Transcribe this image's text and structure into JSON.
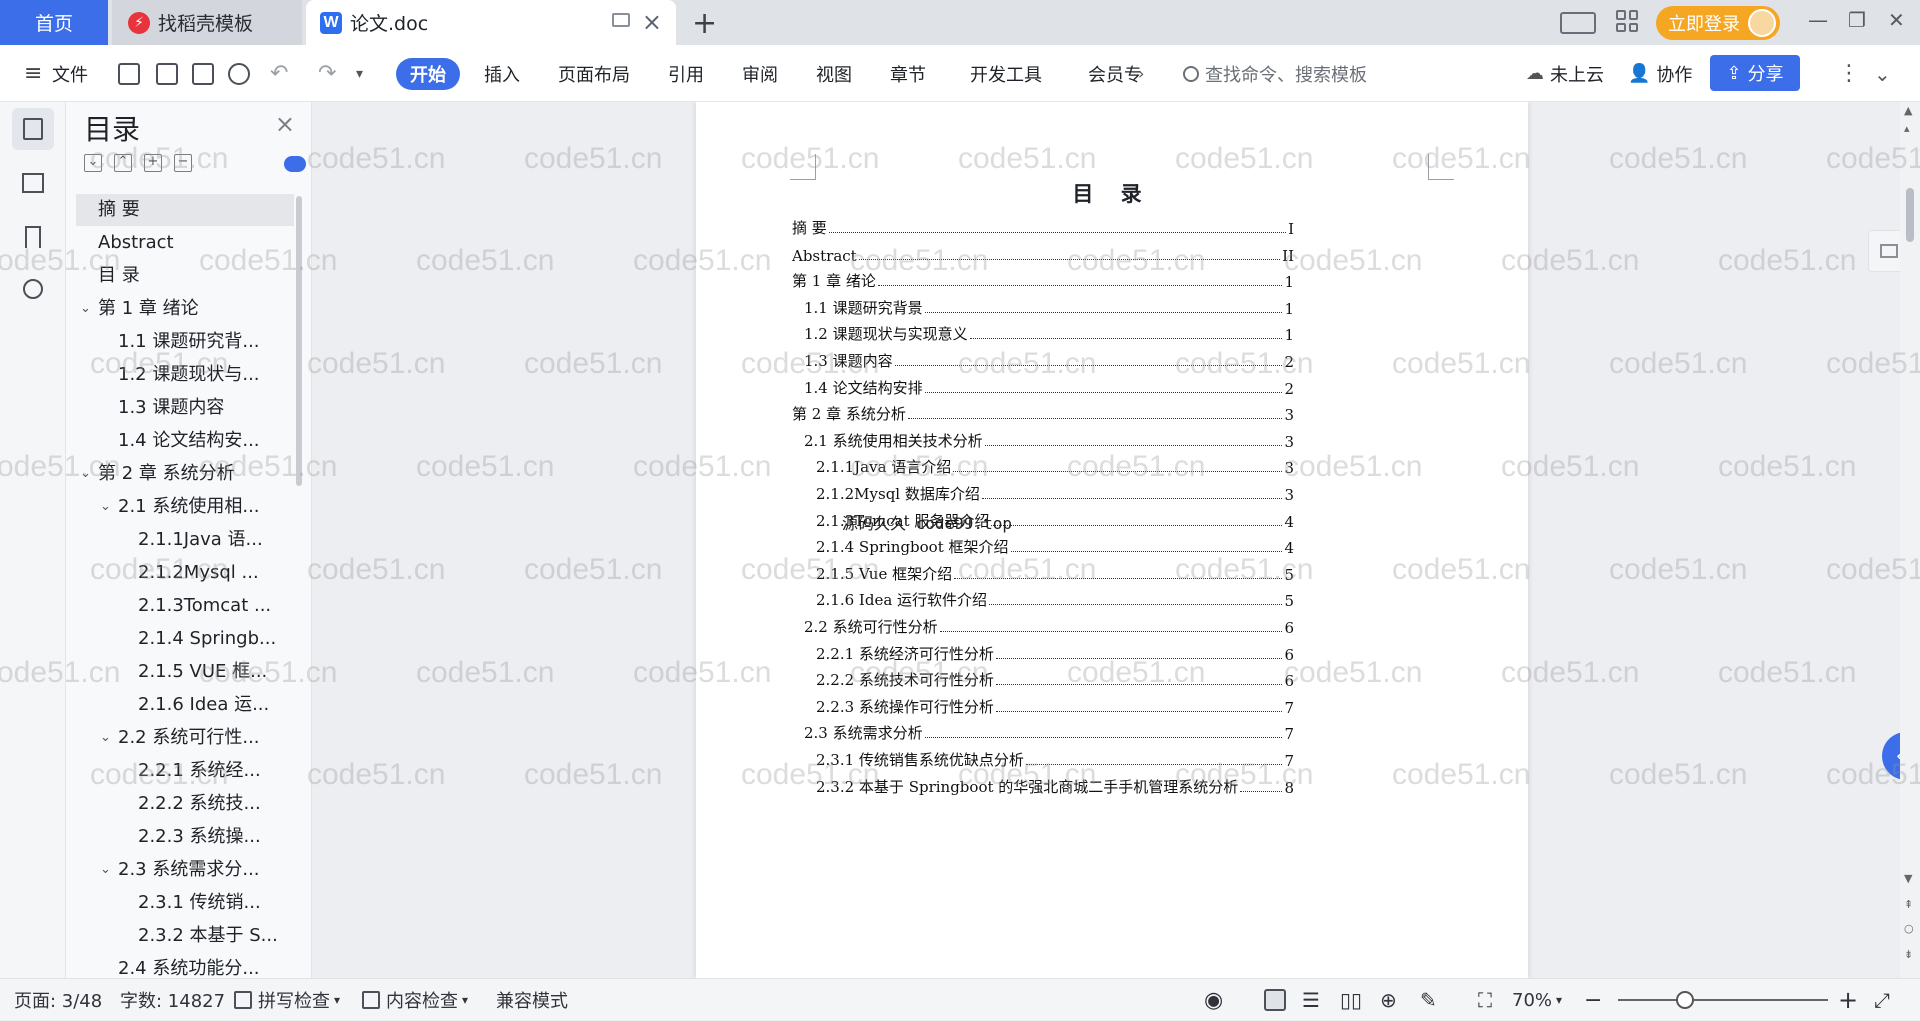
{
  "tabs": {
    "home": "首页",
    "template": "找稻壳模板",
    "doc": "论文.doc",
    "new_tab": "+"
  },
  "header": {
    "login": "立即登录"
  },
  "menu": {
    "file": "文件",
    "start": "开始",
    "insert": "插入",
    "page_layout": "页面布局",
    "reference": "引用",
    "review": "审阅",
    "view": "视图",
    "chapter": "章节",
    "dev_tools": "开发工具",
    "member": "会员专",
    "search_placeholder": "查找命令、搜索模板",
    "cloud": "未上云",
    "collab": "协作",
    "share": "分享"
  },
  "outline": {
    "title": "目录",
    "items": [
      {
        "label": "摘    要",
        "level": 0
      },
      {
        "label": "Abstract",
        "level": 0
      },
      {
        "label": "目  录",
        "level": 0
      },
      {
        "label": "第 1 章    绪论",
        "level": 0,
        "expanded": true
      },
      {
        "label": "1.1 课题研究背...",
        "level": 1
      },
      {
        "label": "1.2 课题现状与...",
        "level": 1
      },
      {
        "label": "1.3 课题内容",
        "level": 1
      },
      {
        "label": "1.4 论文结构安...",
        "level": 1
      },
      {
        "label": "第 2 章    系统分析",
        "level": 0,
        "expanded": true
      },
      {
        "label": "2.1 系统使用相...",
        "level": 1,
        "expanded": true
      },
      {
        "label": "2.1.1Java 语...",
        "level": 2
      },
      {
        "label": "2.1.2Mysql ...",
        "level": 2
      },
      {
        "label": "2.1.3Tomcat ...",
        "level": 2
      },
      {
        "label": "2.1.4 Springb...",
        "level": 2
      },
      {
        "label": "2.1.5 VUE 框...",
        "level": 2
      },
      {
        "label": "2.1.6 Idea 运...",
        "level": 2
      },
      {
        "label": "2.2 系统可行性...",
        "level": 1,
        "expanded": true
      },
      {
        "label": "2.2.1 系统经...",
        "level": 2
      },
      {
        "label": "2.2.2 系统技...",
        "level": 2
      },
      {
        "label": "2.2.3 系统操...",
        "level": 2
      },
      {
        "label": "2.3 系统需求分...",
        "level": 1,
        "expanded": true
      },
      {
        "label": "2.3.1 传统销...",
        "level": 2
      },
      {
        "label": "2.3.2 本基于 S...",
        "level": 2
      },
      {
        "label": "2.4 系统功能分...",
        "level": 1
      }
    ]
  },
  "document": {
    "title": "目 录",
    "source_note": "源码久久 code99.top",
    "toc": [
      {
        "text": "摘    要",
        "page": "I",
        "level": 0
      },
      {
        "text": "Abstract",
        "page": "II",
        "level": 0
      },
      {
        "text": "第 1 章    绪论",
        "page": "1",
        "level": 0
      },
      {
        "text": "1.1 课题研究背景",
        "page": "1",
        "level": 1
      },
      {
        "text": "1.2 课题现状与实现意义",
        "page": "1",
        "level": 1
      },
      {
        "text": "1.3 课题内容",
        "page": "2",
        "level": 1
      },
      {
        "text": "1.4 论文结构安排",
        "page": "2",
        "level": 1
      },
      {
        "text": "第 2 章    系统分析",
        "page": "3",
        "level": 0
      },
      {
        "text": "2.1 系统使用相关技术分析",
        "page": "3",
        "level": 1
      },
      {
        "text": "2.1.1Java 语言介绍",
        "page": "3",
        "level": 2
      },
      {
        "text": "2.1.2Mysql 数据库介绍",
        "page": "3",
        "level": 2
      },
      {
        "text": "2.1.3Tomcat 服务器介绍",
        "page": "4",
        "level": 2
      },
      {
        "text": "2.1.4 Springboot 框架介绍",
        "page": "4",
        "level": 2
      },
      {
        "text": "2.1.5 Vue 框架介绍",
        "page": "5",
        "level": 2
      },
      {
        "text": "2.1.6 Idea 运行软件介绍",
        "page": "5",
        "level": 2
      },
      {
        "text": "2.2 系统可行性分析",
        "page": "6",
        "level": 1
      },
      {
        "text": "2.2.1 系统经济可行性分析",
        "page": "6",
        "level": 2
      },
      {
        "text": "2.2.2 系统技术可行性分析",
        "page": "6",
        "level": 2
      },
      {
        "text": "2.2.3 系统操作可行性分析",
        "page": "7",
        "level": 2
      },
      {
        "text": "2.3 系统需求分析",
        "page": "7",
        "level": 1
      },
      {
        "text": "2.3.1 传统销售系统优缺点分析",
        "page": "7",
        "level": 2
      },
      {
        "text": "2.3.2 本基于 Springboot 的华强北商城二手手机管理系统分析",
        "page": "8",
        "level": 2
      }
    ]
  },
  "watermark": "code51.cn",
  "status": {
    "page": "页面: 3/48",
    "words": "字数: 14827",
    "spell": "拼写检查",
    "content_check": "内容检查",
    "compat": "兼容模式",
    "zoom": "70%"
  }
}
